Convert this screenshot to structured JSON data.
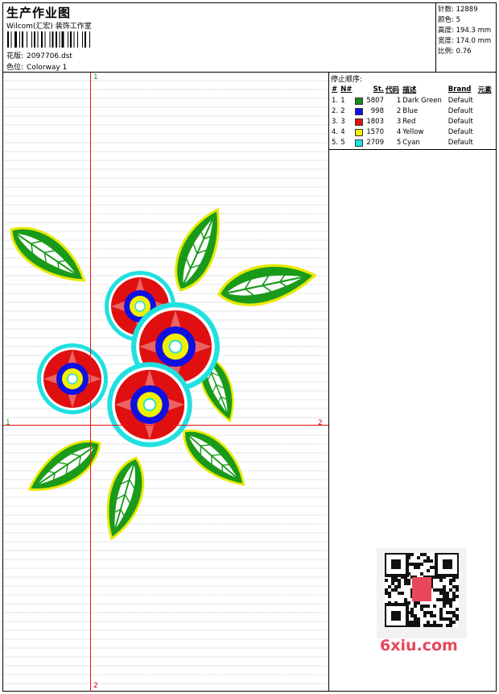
{
  "header": {
    "title": "生产作业图",
    "company": "Wilcom(汇宏) 装饰工作室",
    "design_label": "花版:",
    "design_value": "2097706.dst",
    "colorway_label": "色位:",
    "colorway_value": "Colorway 1"
  },
  "stats": [
    {
      "label": "针数:",
      "value": "12889"
    },
    {
      "label": "颜色:",
      "value": "5"
    },
    {
      "label": "高度:",
      "value": "194.3 mm"
    },
    {
      "label": "宽度:",
      "value": "174.0 mm"
    },
    {
      "label": "比例:",
      "value": "0.76"
    }
  ],
  "guides": {
    "top": "1",
    "left": "1",
    "right": "2",
    "bottom": "2"
  },
  "stop_sequence": {
    "title": "停止顺序:",
    "columns": [
      "#",
      "N#",
      "St.",
      "代码",
      "描述",
      "Brand",
      "元素"
    ],
    "rows": [
      {
        "idx": "1.",
        "n": "1",
        "color": "#1a8a1a",
        "st": "5807",
        "code": "1",
        "desc": "Dark Green",
        "brand": "Default"
      },
      {
        "idx": "2.",
        "n": "2",
        "color": "#1010e0",
        "st": "998",
        "code": "2",
        "desc": "Blue",
        "brand": "Default"
      },
      {
        "idx": "3.",
        "n": "3",
        "color": "#e01010",
        "st": "1803",
        "code": "3",
        "desc": "Red",
        "brand": "Default"
      },
      {
        "idx": "4.",
        "n": "4",
        "color": "#f0f000",
        "st": "1570",
        "code": "4",
        "desc": "Yellow",
        "brand": "Default"
      },
      {
        "idx": "5.",
        "n": "5",
        "color": "#20e0e0",
        "st": "2709",
        "code": "5",
        "desc": "Cyan",
        "brand": "Default"
      }
    ]
  },
  "watermark": "6xiu.com",
  "colors": {
    "guide": "#ee1111",
    "leaf": "#1a9a1a",
    "leaf_edge": "#e8e800",
    "petal": "#e01010",
    "center_blue": "#1010e0",
    "center_yellow": "#f0f000",
    "outline": "#20e0e0"
  }
}
